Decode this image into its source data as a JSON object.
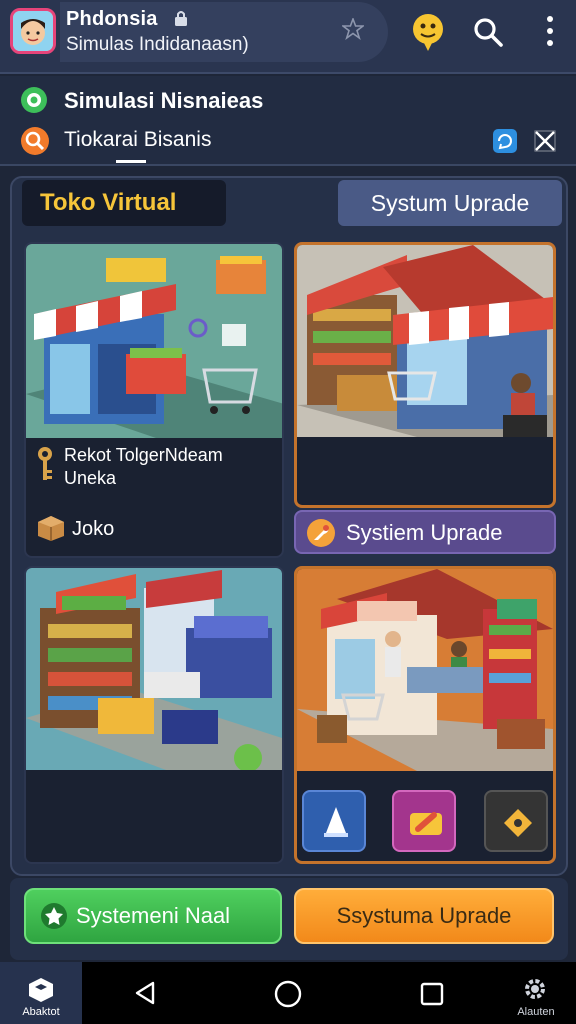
{
  "app": {
    "title": "Phdonsia",
    "subtitle": "Simulas Indidanaasn)"
  },
  "header": {
    "line1": "Simulasi Nisnaieas",
    "line2": "Tiokarai Bisanis"
  },
  "tabs": {
    "toko": "Toko Virtual",
    "upgrade": "Systum Uprade"
  },
  "cards": {
    "a": {
      "desc": "Rekot TolgerNdeam Uneka",
      "owner": "Joko"
    },
    "b": {
      "button": "Systiem Uprade"
    }
  },
  "buttons": {
    "green": "Systemeni Naal",
    "orange": "Ssystuma Uprade"
  },
  "navbar": {
    "home_label": "Abaktot",
    "settings_label": "Alauten"
  },
  "colors": {
    "accent_gold": "#f6c53a",
    "upgrade_purple": "#5a4b8e",
    "green": "#3bb64c",
    "orange": "#f59a27"
  }
}
